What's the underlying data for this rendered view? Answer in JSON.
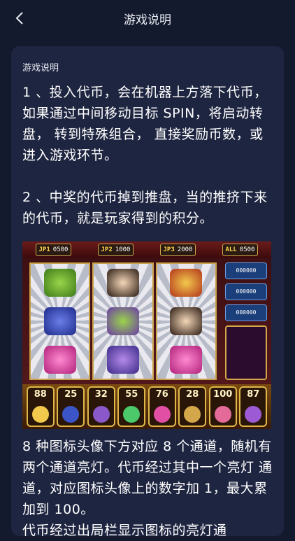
{
  "header": {
    "title": "游戏说明"
  },
  "card": {
    "heading": "游戏说明",
    "p1": "1 、投入代币，会在机器上方落下代币，如果通过中间移动目标 SPIN，将启动转盘， 转到特殊组合， 直接奖励币数，或进入游戏环节。",
    "p2": "2 、中奖的代币掉到推盘，当的推挤下来的代币，就是玩家得到的积分。",
    "p3": "8 种图标头像下方对应 8 个通道，随机有两个通道亮灯。代币经过其中一个亮灯 通道，对应图标头像上的数字加 1，最大累加到 100。",
    "p4": "代币经过出局栏显示图标的亮灯通"
  },
  "game": {
    "jackpots": [
      {
        "key": "JP1",
        "value": "0500"
      },
      {
        "key": "JP2",
        "value": "1000"
      },
      {
        "key": "JP3",
        "value": "2000"
      },
      {
        "key": "ALL",
        "value": "0500"
      }
    ],
    "side_counters": [
      "000000",
      "000000",
      "000000"
    ],
    "channels": [
      {
        "num": "88",
        "color": "#f2c94c"
      },
      {
        "num": "25",
        "color": "#3b55c9"
      },
      {
        "num": "32",
        "color": "#8a58c9"
      },
      {
        "num": "55",
        "color": "#4cc96a"
      },
      {
        "num": "76",
        "color": "#e04fa4"
      },
      {
        "num": "28",
        "color": "#d4a84a"
      },
      {
        "num": "100",
        "color": "#e46a9a"
      },
      {
        "num": "87",
        "color": "#9c5ad4"
      }
    ]
  }
}
